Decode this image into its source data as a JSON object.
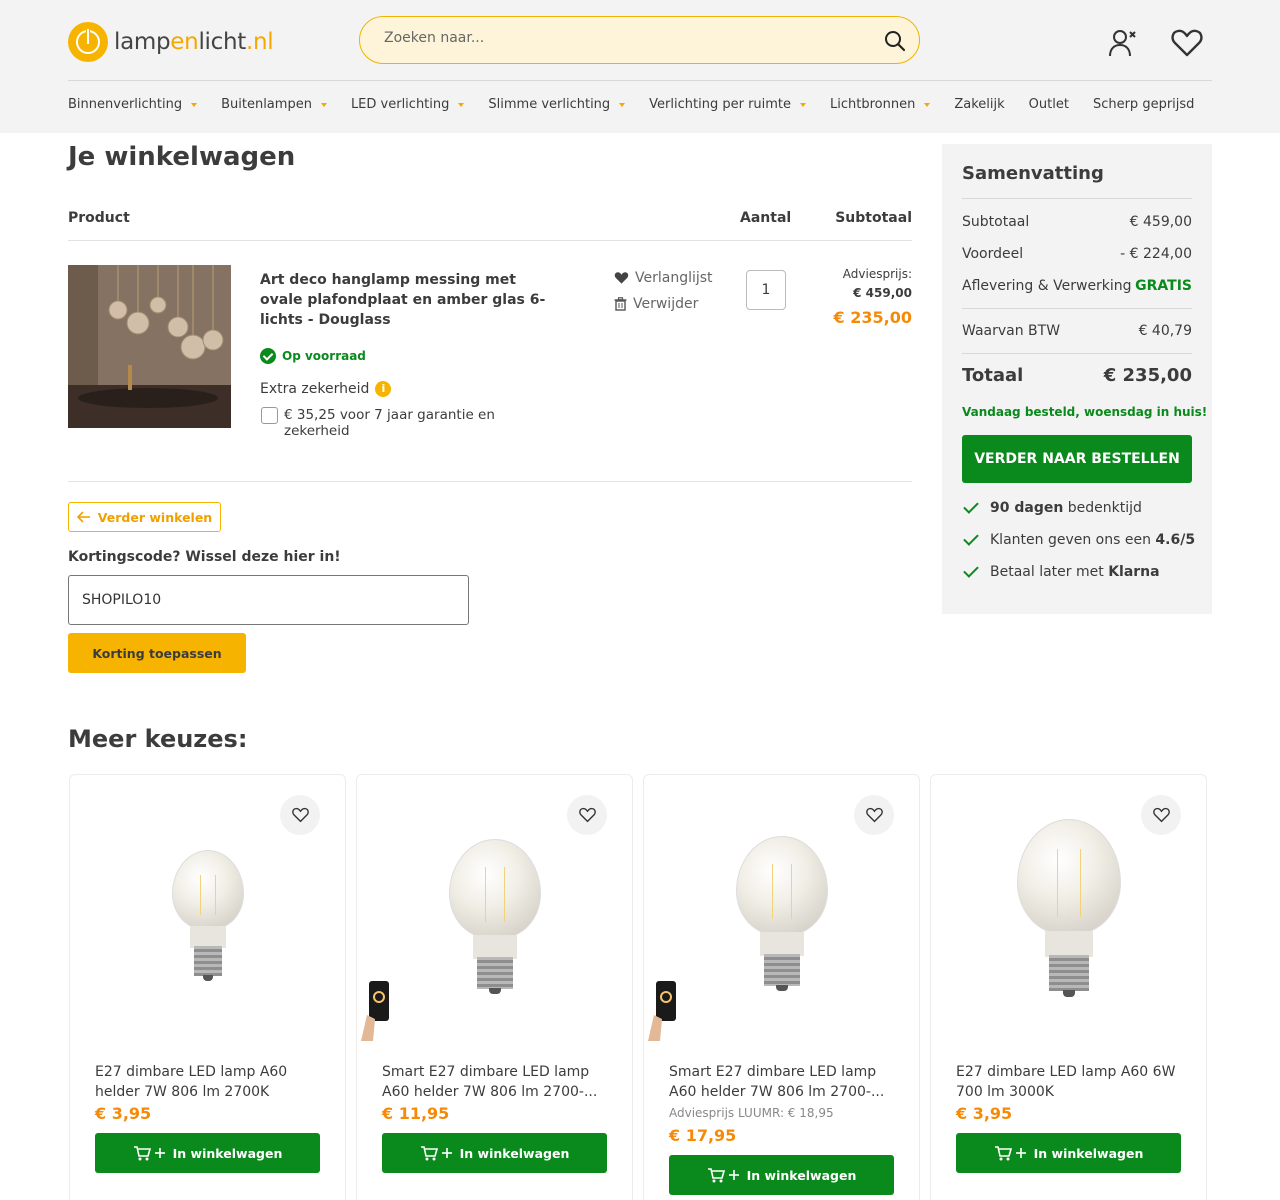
{
  "header": {
    "logo": {
      "part1": "lamp",
      "part2": "en",
      "part3": "licht",
      "part4": ".nl"
    },
    "search_placeholder": "Zoeken naar...",
    "nav": [
      {
        "label": "Binnenverlichting",
        "dropdown": true
      },
      {
        "label": "Buitenlampen",
        "dropdown": true
      },
      {
        "label": "LED verlichting",
        "dropdown": true
      },
      {
        "label": "Slimme verlichting",
        "dropdown": true
      },
      {
        "label": "Verlichting per ruimte",
        "dropdown": true
      },
      {
        "label": "Lichtbronnen",
        "dropdown": true
      },
      {
        "label": "Zakelijk",
        "dropdown": false
      },
      {
        "label": "Outlet",
        "dropdown": false
      },
      {
        "label": "Scherp geprijsd",
        "dropdown": false
      }
    ]
  },
  "cart": {
    "title": "Je winkelwagen",
    "col_product": "Product",
    "col_qty": "Aantal",
    "col_subtotal": "Subtotaal",
    "item": {
      "name": "Art deco hanglamp messing met ovale plafondplaat en amber glas 6-lichts - Douglass",
      "stock": "Op voorraad",
      "extra_title": "Extra zekerheid",
      "extra_option": "€ 35,25 voor 7 jaar garantie en zekerheid",
      "wishlist": "Verlanglijst",
      "remove": "Verwijder",
      "qty": "1",
      "advies_label": "Adviesprijs:",
      "advies_value": "€ 459,00",
      "price": "€ 235,00"
    },
    "continue_label": "Verder winkelen",
    "coupon_label": "Kortingscode? Wissel deze hier in!",
    "coupon_value": "SHOPILO10",
    "coupon_button": "Korting toepassen"
  },
  "summary": {
    "title": "Samenvatting",
    "subtotal_label": "Subtotaal",
    "subtotal_value": "€ 459,00",
    "discount_label": "Voordeel",
    "discount_value": "- € 224,00",
    "shipping_label": "Aflevering & Verwerking",
    "shipping_value": "GRATIS",
    "vat_label": "Waarvan BTW",
    "vat_value": "€ 40,79",
    "total_label": "Totaal",
    "total_value": "€ 235,00",
    "delivery_note": "Vandaag besteld, woensdag in huis!",
    "order_button": "VERDER NAAR BESTELLEN",
    "usps": [
      {
        "bold": "90 dagen",
        "rest": " bedenktijd",
        "bold_first": true
      },
      {
        "rest": "Klanten geven ons een ",
        "bold": "4.6/5",
        "bold_first": false
      },
      {
        "rest": "Betaal later met ",
        "bold": "Klarna",
        "bold_first": false
      }
    ]
  },
  "more": {
    "title": "Meer keuzes:",
    "add_label": "In winkelwagen",
    "products": [
      {
        "name_line1": "E27 dimbare LED lamp A60",
        "name_line2": "helder 7W 806 lm 2700K",
        "advies": "",
        "price": "€ 3,95",
        "phone": false
      },
      {
        "name_line1": "Smart E27 dimbare LED lamp",
        "name_line2": "A60 helder 7W 806 lm 2700-...",
        "advies": "",
        "price": "€ 11,95",
        "phone": true
      },
      {
        "name_line1": "Smart E27 dimbare LED lamp",
        "name_line2": "A60 helder 7W 806 lm 2700-...",
        "advies": "Adviesprijs LUUMR: € 18,95",
        "price": "€ 17,95",
        "phone": true
      },
      {
        "name_line1": "E27 dimbare LED lamp A60 6W",
        "name_line2": "700 lm 3000K",
        "advies": "",
        "price": "€ 3,95",
        "phone": false
      }
    ]
  },
  "colors": {
    "accent": "#f6b400",
    "price": "#f58a07",
    "green": "#0a8a1c"
  }
}
